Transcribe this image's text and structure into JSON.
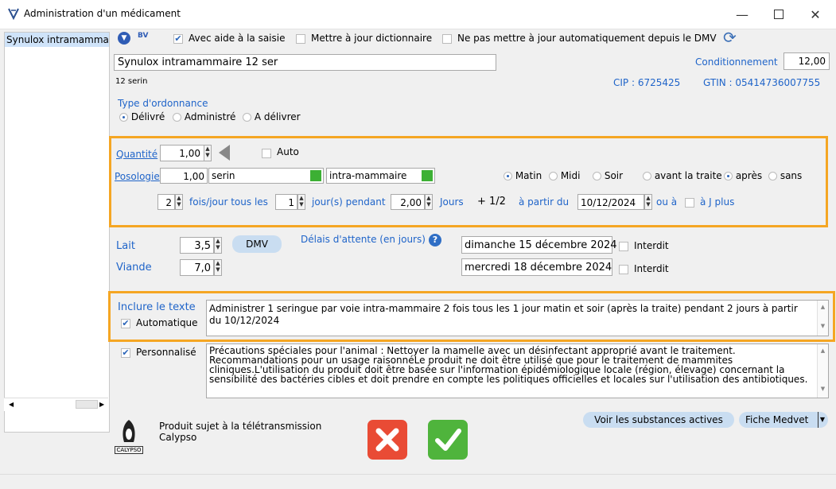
{
  "window": {
    "title": "Administration d'un médicament",
    "min_icon": "minimize-icon",
    "max_icon": "maximize-icon",
    "close_icon": "close-icon"
  },
  "sidebar": {
    "selected_item": "Synulox intramammai"
  },
  "header": {
    "bv_label": "BV",
    "assist_label": "Avec aide à la saisie",
    "update_dict_label": "Mettre à jour dictionnaire",
    "no_update_dmv_label": "Ne pas mettre à jour automatiquement depuis le DMV",
    "product_name": "Synulox intramammaire 12 ser",
    "conditionnement_label": "Conditionnement",
    "conditionnement_value": "12,00",
    "unit": "12 serin",
    "cip": "CIP : 6725425",
    "gtin": "GTIN : 05414736007755"
  },
  "ordonnance": {
    "label": "Type d'ordonnance",
    "options": [
      "Délivré",
      "Administré",
      "A délivrer"
    ],
    "selected": "Délivré"
  },
  "posologie": {
    "quantite_label": "Quantité",
    "quantite_value": "1,00",
    "auto_label": "Auto",
    "posologie_label": "Posologie",
    "posologie_value": "1,00",
    "unit_value": "serin",
    "route_value": "intra-mammaire",
    "moments": [
      "Matin",
      "Midi",
      "Soir",
      "avant la traite",
      "après",
      "sans"
    ],
    "moments_selected": [
      "Matin",
      "après"
    ],
    "fois_value": "2",
    "fois_label": "fois/jour tous les",
    "jours_value": "1",
    "jours_label": "jour(s) pendant",
    "duree_value": "2,00",
    "duree_unit": "Jours",
    "plus_half": "+ 1/2",
    "a_partir_label": "à partir du",
    "date_value": "10/12/2024",
    "ou_a_label": "ou à",
    "j_plus_label": "à J plus"
  },
  "attente": {
    "lait_label": "Lait",
    "lait_value": "3,5",
    "dmv_label": "DMV",
    "viande_label": "Viande",
    "viande_value": "7,0",
    "delais_label": "Délais d'attente (en jours)",
    "lait_date": "dimanche 15 décembre 2024",
    "viande_date": "mercredi 18 décembre 2024",
    "interdit_label": "Interdit"
  },
  "texte": {
    "inclure_label": "Inclure le texte",
    "auto_label": "Automatique",
    "auto_text": "Administrer 1 seringue par voie intra-mammaire 2 fois tous les 1 jour matin et soir (après la traite) pendant 2 jours à partir du 10/12/2024",
    "perso_label": "Personnalisé",
    "perso_text": "Précautions spéciales pour l'animal : Nettoyer la mamelle avec un désinfectant approprié avant le traitement. Recommandations pour un usage raisonnéLe produit ne doit être utilisé que pour le traitement de mammites cliniques.L'utilisation du produit doit être basée sur l'information épidémiologique locale (région, élevage) concernant la sensibilité des bactéries cibles et doit prendre en compte les politiques officielles et locales sur l'utilisation des antibiotiques."
  },
  "footer": {
    "tele_label": "Produit sujet à la télétransmission",
    "calypso_label": "Calypso",
    "logo_text": "CALYPSO",
    "voir_label": "Voir les substances actives",
    "medvet_label": "Fiche Medvet"
  },
  "colors": {
    "highlight": "#f5a623",
    "accent_blue": "#1f64c9",
    "cancel_red": "#e94b35",
    "ok_green": "#4fb43c"
  }
}
